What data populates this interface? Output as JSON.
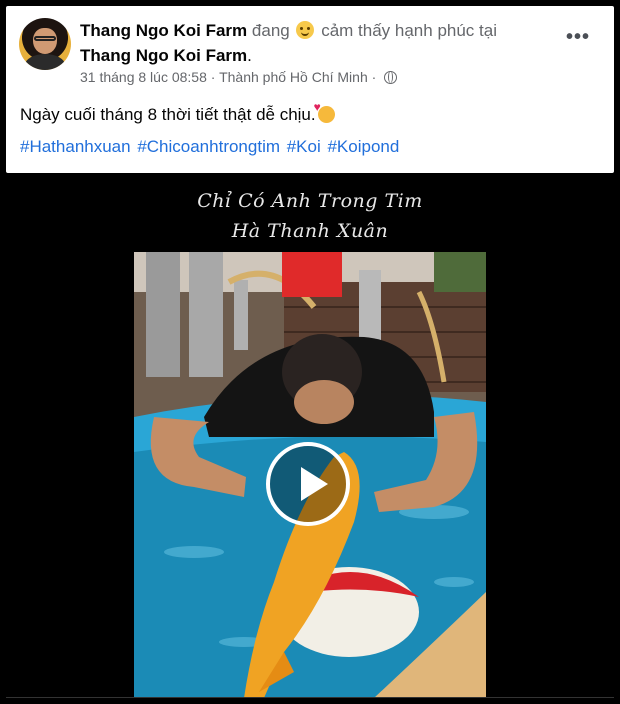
{
  "post": {
    "author": "Thang Ngo Koi Farm",
    "feeling_prefix": "đang",
    "feeling_text": "cảm thấy hạnh phúc tại",
    "place": "Thang Ngo Koi Farm",
    "place_suffix": ".",
    "more_label": "•••",
    "date": "31 tháng 8 lúc 08:58",
    "separator": "·",
    "location": "Thành phố Hồ Chí Minh",
    "separator2": "·",
    "text": "Ngày cuối tháng 8 thời tiết thật dễ chịu.",
    "hashtags": "#Hathanhxuan #Chicoanhtrongtim #Koi #Koipond"
  },
  "video": {
    "title_line1": "Chỉ Có Anh Trong Tim",
    "title_line2": "Hà Thanh Xuân"
  },
  "icons": {
    "avatar": "avatar-photo",
    "feeling": "smiley-icon",
    "globe": "globe-icon",
    "emoji": "smiling-face-with-hearts-icon",
    "play": "play-icon",
    "more": "more-horizontal-icon"
  },
  "colors": {
    "link": "#216fdb",
    "muted": "#65676b",
    "text": "#050505",
    "pool": "#1f9bc4",
    "koi": "#f0a323"
  }
}
